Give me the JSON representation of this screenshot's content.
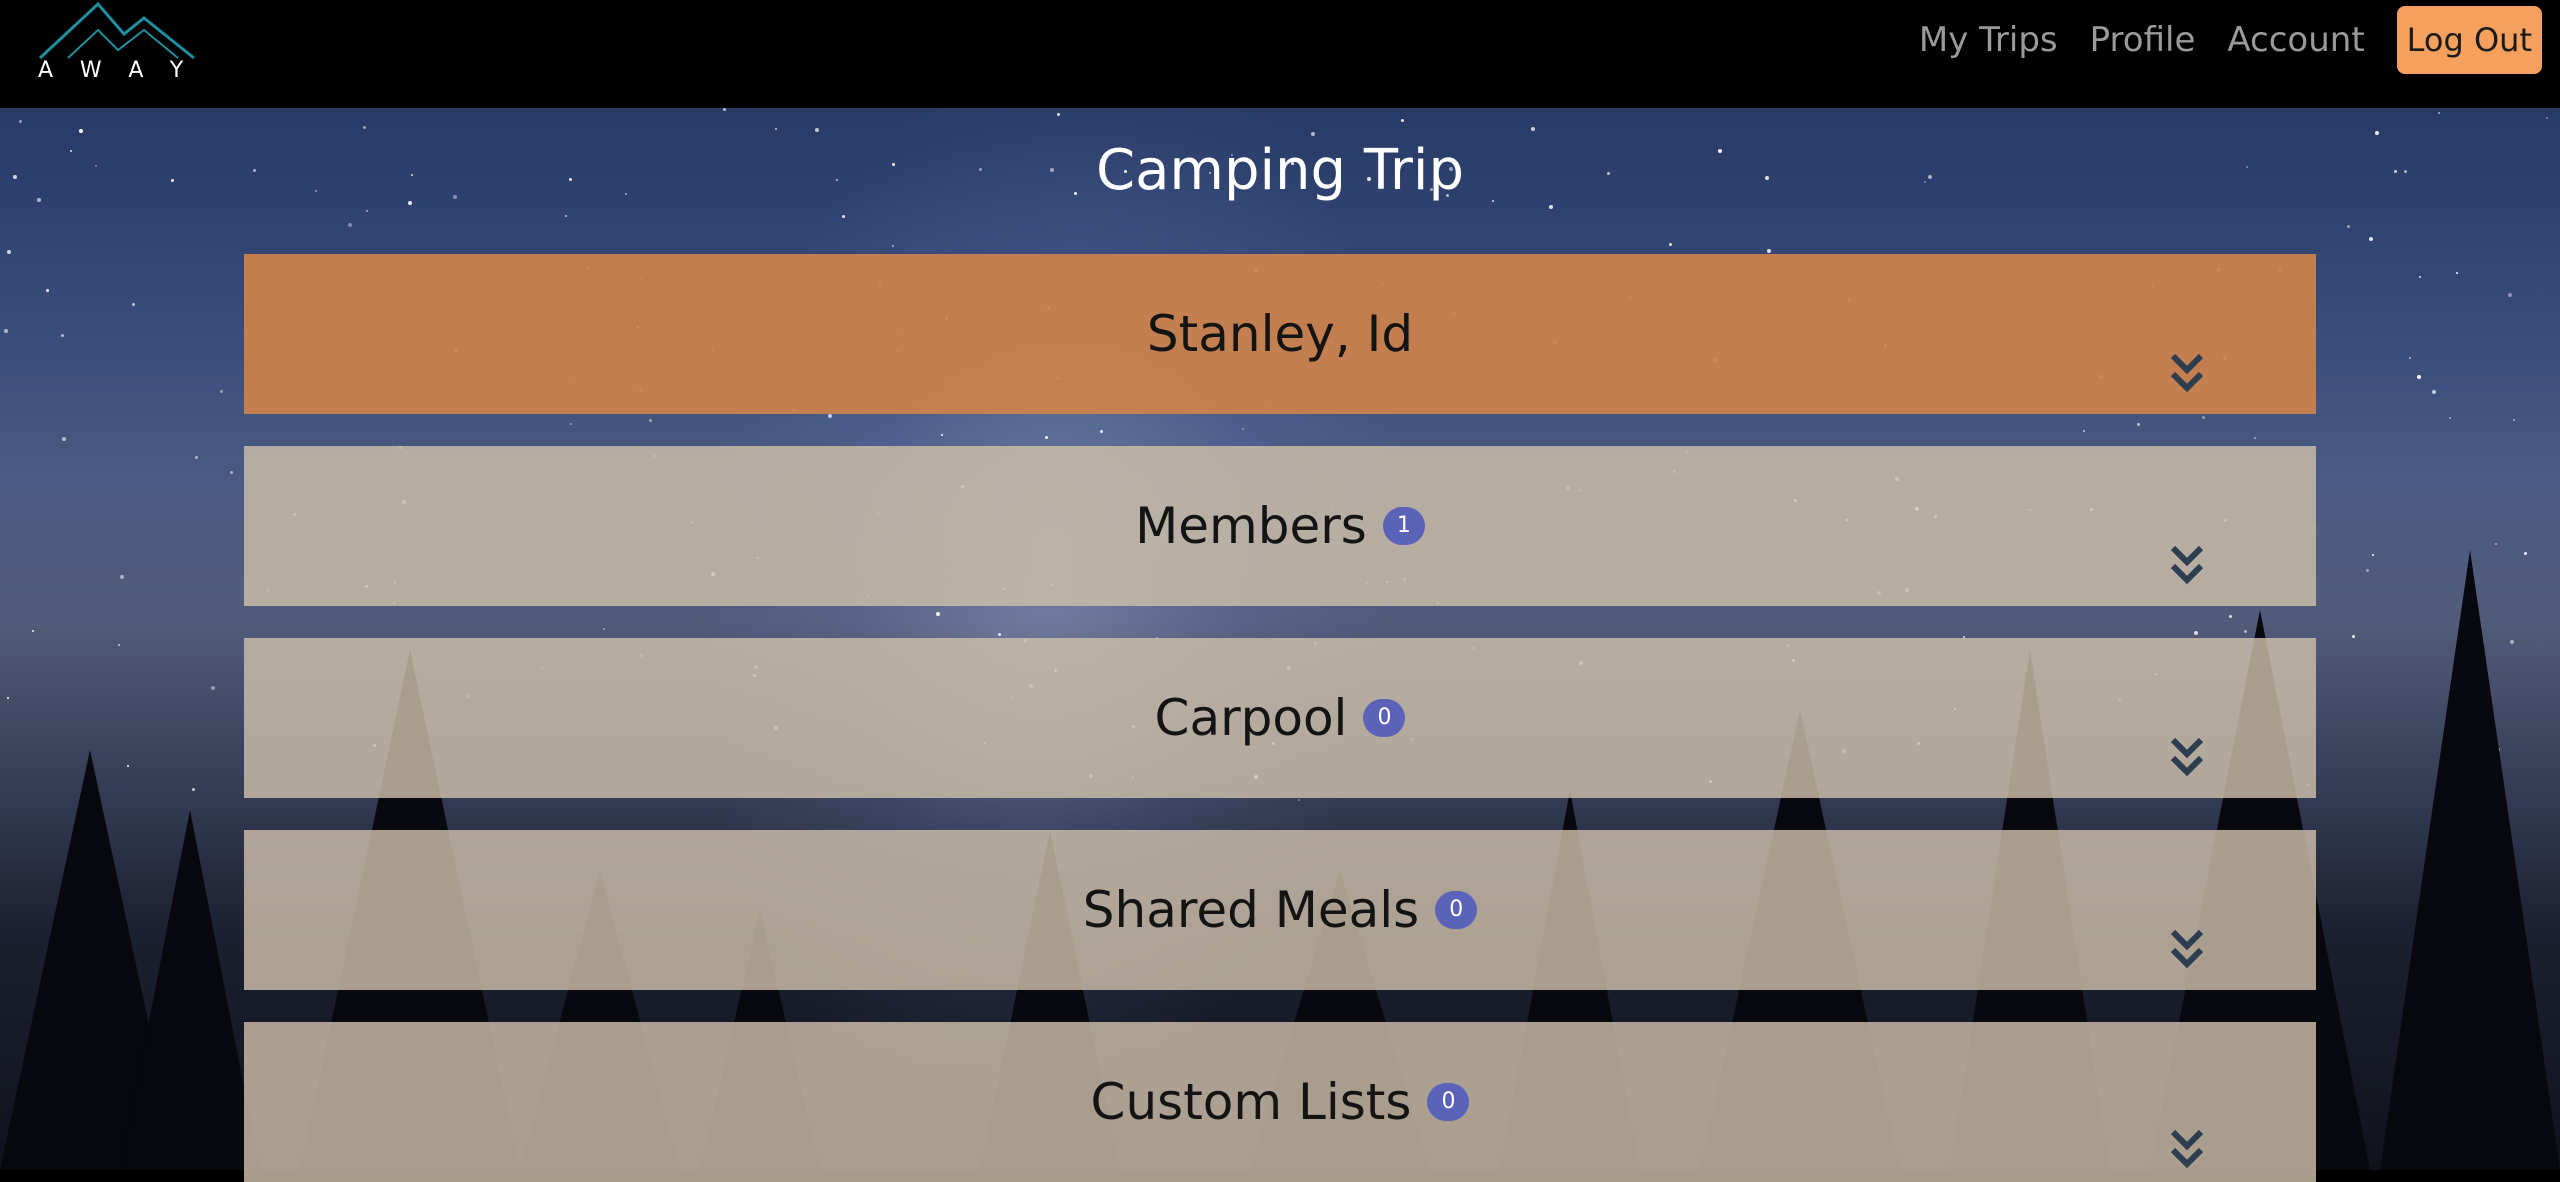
{
  "brand": {
    "logo_text": "AWAY"
  },
  "nav": {
    "links": [
      "My Trips",
      "Profile",
      "Account"
    ],
    "logout_label": "Log Out"
  },
  "page": {
    "title": "Camping Trip"
  },
  "panels": [
    {
      "label": "Stanley, Id",
      "badge": null,
      "style": "primary",
      "expand_icon": "chevron-double-down-icon"
    },
    {
      "label": "Members",
      "badge": "1",
      "style": "secondary",
      "expand_icon": "chevron-double-down-icon"
    },
    {
      "label": "Carpool",
      "badge": "0",
      "style": "secondary",
      "expand_icon": "chevron-double-down-icon"
    },
    {
      "label": "Shared Meals",
      "badge": "0",
      "style": "secondary",
      "expand_icon": "chevron-double-down-icon"
    },
    {
      "label": "Custom Lists",
      "badge": "0",
      "style": "secondary",
      "expand_icon": "chevron-double-down-icon"
    }
  ],
  "colors": {
    "accent_orange": "#f5a05d",
    "panel_primary": "#cd824b",
    "panel_secondary": "#cdbeaa",
    "badge": "#5b63b8",
    "logo_stroke": "#1f8fa0",
    "chevron": "#2c3e50"
  }
}
